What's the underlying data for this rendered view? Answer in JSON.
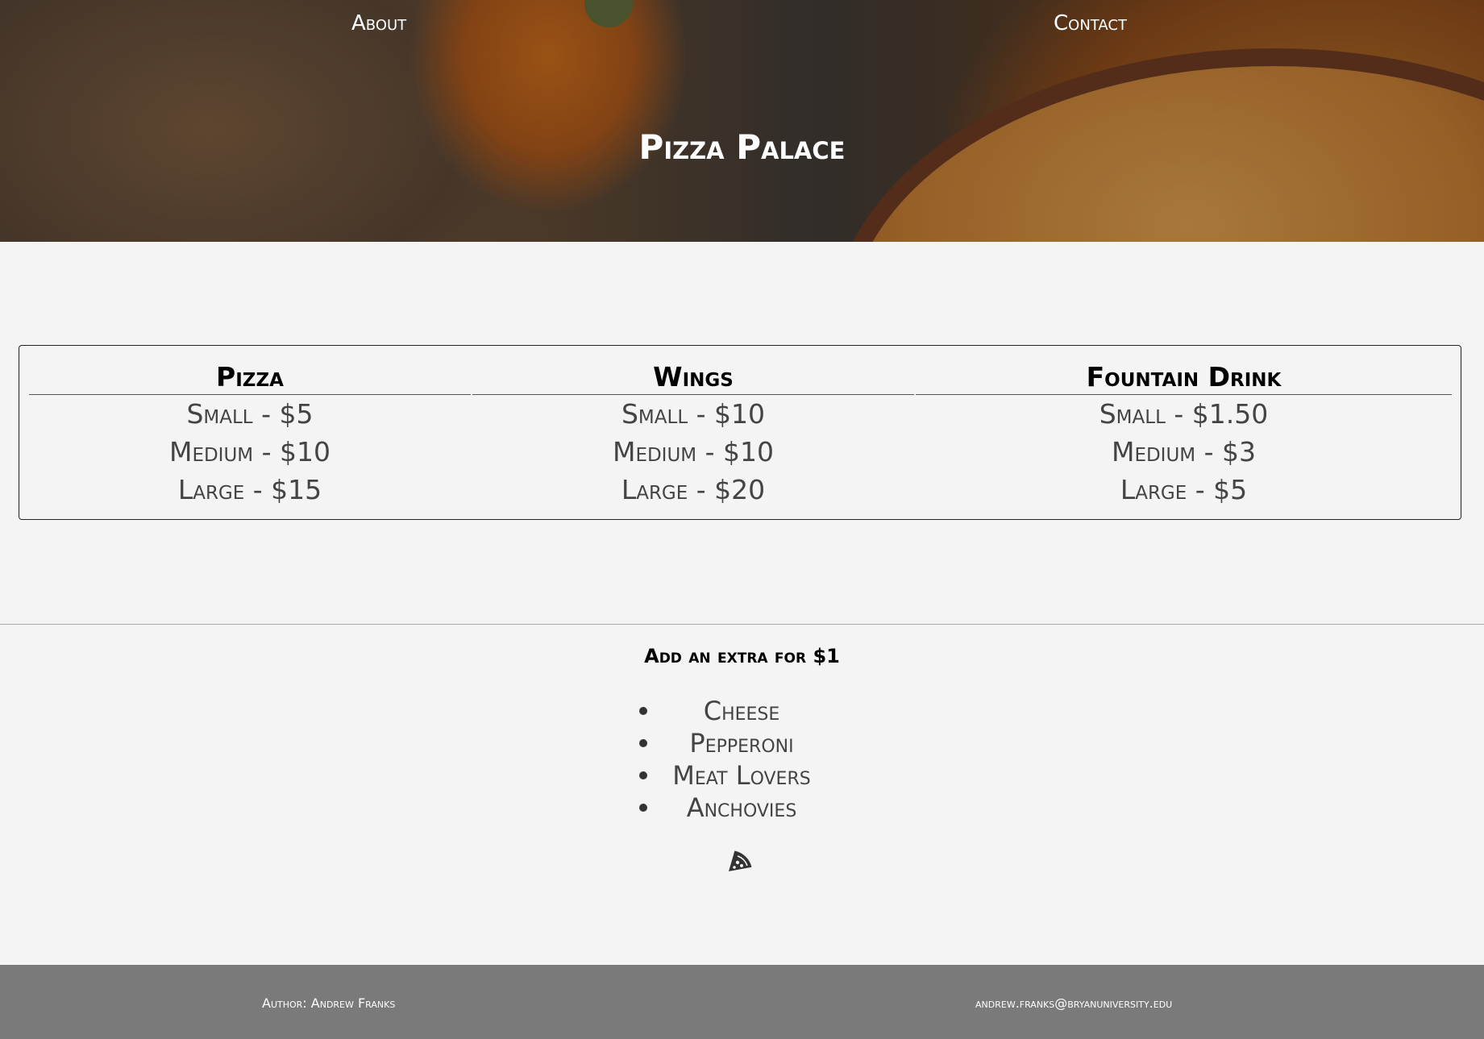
{
  "nav": {
    "about_label": "About",
    "contact_label": "Contact"
  },
  "header": {
    "title": "Pizza Palace"
  },
  "menu": {
    "columns": [
      {
        "heading": "Pizza",
        "items": [
          "Small - $5",
          "Medium - $10",
          "Large - $15"
        ]
      },
      {
        "heading": "Wings",
        "items": [
          "Small - $10",
          "Medium - $10",
          "Large - $20"
        ]
      },
      {
        "heading": "Fountain Drink",
        "items": [
          "Small - $1.50",
          "Medium - $3",
          "Large - $5"
        ]
      }
    ]
  },
  "extras": {
    "heading": "Add an extra for $1",
    "items": [
      "Cheese",
      "Pepperoni",
      "Meat Lovers",
      "Anchovies"
    ],
    "icon": "pizza-slice-icon"
  },
  "footer": {
    "author": "Author: Andrew Franks",
    "email": "andrew.franks@bryanuniversity.edu",
    "background_color": "#7a7a7a"
  }
}
